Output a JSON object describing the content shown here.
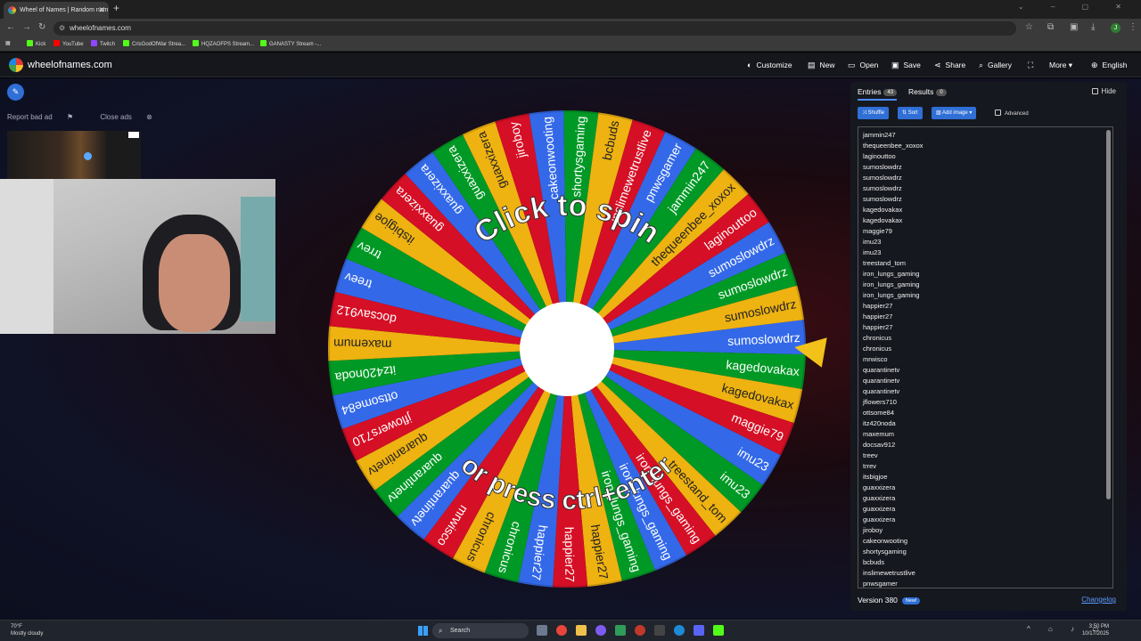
{
  "browser": {
    "tab_title": "Wheel of Names | Random nam",
    "url": "wheelofnames.com",
    "bookmarks": [
      {
        "label": "Kick",
        "color": "#53fc18"
      },
      {
        "label": "YouTube",
        "color": "#ff0000"
      },
      {
        "label": "Twitch",
        "color": "#9146ff"
      },
      {
        "label": "CrisGodOfWar Strea...",
        "color": "#53fc18"
      },
      {
        "label": "HQZAOFPS Stream...",
        "color": "#53fc18"
      },
      {
        "label": "GANASTY Stream -...",
        "color": "#53fc18"
      }
    ]
  },
  "site": {
    "name": "wheelofnames.com",
    "nav": [
      {
        "label": "Customize",
        "icon": "palette-icon"
      },
      {
        "label": "New",
        "icon": "file-icon"
      },
      {
        "label": "Open",
        "icon": "folder-icon"
      },
      {
        "label": "Save",
        "icon": "save-icon"
      },
      {
        "label": "Share",
        "icon": "share-icon"
      },
      {
        "label": "Gallery",
        "icon": "search-icon"
      },
      {
        "label": "",
        "icon": "fullscreen-icon"
      },
      {
        "label": "More",
        "icon": "chevron-down-icon"
      },
      {
        "label": "English",
        "icon": "globe-icon"
      }
    ]
  },
  "ads": {
    "report": "Report bad ad",
    "close": "Close ads"
  },
  "wheel": {
    "top_text": "Click to spin",
    "bottom_text": "or press ctrl+enter",
    "colors": [
      "#3369e8",
      "#009925",
      "#eeb211",
      "#d50f25"
    ],
    "pointer_color": "#f2c21b",
    "segments": [
      "sumoslowdrz",
      "kagedovakax",
      "kagedovakax",
      "maggie79",
      "imu23",
      "imu23",
      "treestand_tom",
      "iron_lungs_gaming",
      "iron_lungs_gaming",
      "iron_lungs_gaming",
      "happier27",
      "happier27",
      "happier27",
      "chronicus",
      "chronicus",
      "mrwisco",
      "quarantinetv",
      "quarantinetv",
      "quarantinetv",
      "jflowers710",
      "ottsome84",
      "itz420noda",
      "maxemum",
      "docsav912",
      "treev",
      "trrev",
      "itsbigjoe",
      "guaxxizera",
      "guaxxizera",
      "guaxxizera",
      "guaxxizera",
      "jiroboy",
      "cakeonwooting",
      "shortysgaming",
      "bcbuds",
      "inslimewetrustlive",
      "pnwsgamer",
      "jammin247",
      "thequeenbee_xoxox",
      "laginouttoo",
      "sumoslowdrz",
      "sumoslowdrz",
      "sumoslowdrz"
    ]
  },
  "sidebar": {
    "tab_entries": "Entries",
    "entries_count": "43",
    "tab_results": "Results",
    "results_count": "0",
    "hide": "Hide",
    "shuffle": "Shuffle",
    "sort": "Sort",
    "add_image": "Add image",
    "advanced": "Advanced",
    "entries": [
      "jammin247",
      "thequeenbee_xoxox",
      "laginouttoo",
      "sumoslowdrz",
      "sumoslowdrz",
      "sumoslowdrz",
      "sumoslowdrz",
      "kagedovakax",
      "kagedovakax",
      "maggie79",
      "imu23",
      "imu23",
      "treestand_tom",
      "iron_lungs_gaming",
      "iron_lungs_gaming",
      "iron_lungs_gaming",
      "happier27",
      "happier27",
      "happier27",
      "chronicus",
      "chronicus",
      "mrwisco",
      "quarantinetv",
      "quarantinetv",
      "quarantinetv",
      "jflowers710",
      "ottsome84",
      "itz420noda",
      "maxemum",
      "docsav912",
      "treev",
      "trrev",
      "itsbigjoe",
      "guaxxizera",
      "guaxxizera",
      "guaxxizera",
      "guaxxizera",
      "jiroboy",
      "cakeonwooting",
      "shortysgaming",
      "bcbuds",
      "inslimewetrustlive",
      "pnwsgamer"
    ],
    "version": "Version 380",
    "new_badge": "New!",
    "changelog": "Changelog"
  },
  "taskbar": {
    "temp": "70°F",
    "weather": "Mostly cloudy",
    "search": "Search",
    "time": "3:50 PM",
    "date": "10/17/2025"
  }
}
